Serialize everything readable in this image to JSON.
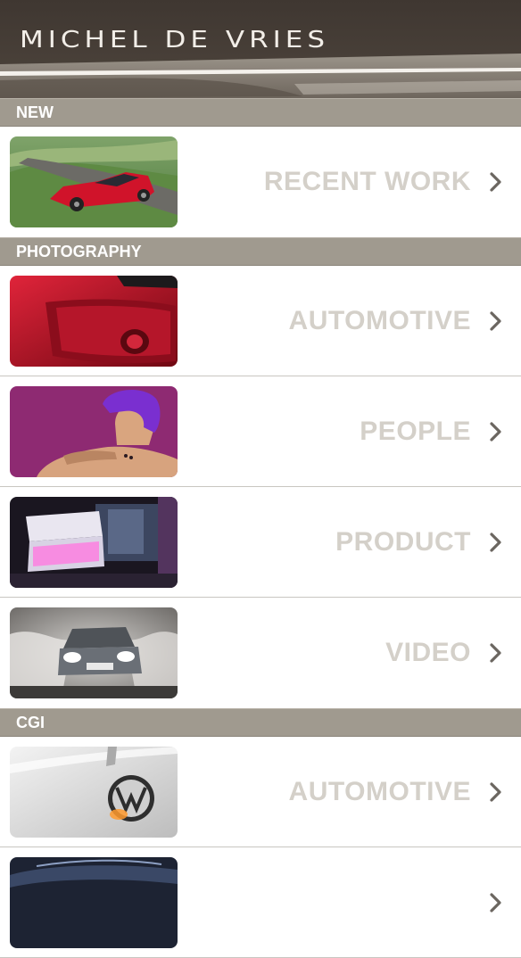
{
  "header": {
    "title": "MICHEL DE VRIES"
  },
  "sections": [
    {
      "title": "NEW",
      "items": [
        {
          "label": "RECENT WORK",
          "icon": "chevron-right-icon"
        }
      ]
    },
    {
      "title": "PHOTOGRAPHY",
      "items": [
        {
          "label": "AUTOMOTIVE",
          "icon": "chevron-right-icon"
        },
        {
          "label": "PEOPLE",
          "icon": "chevron-right-icon"
        },
        {
          "label": "PRODUCT",
          "icon": "chevron-right-icon"
        },
        {
          "label": "VIDEO",
          "icon": "chevron-right-icon"
        }
      ]
    },
    {
      "title": "CGI",
      "items": [
        {
          "label": "AUTOMOTIVE",
          "icon": "chevron-right-icon"
        },
        {
          "label": "",
          "icon": "chevron-right-icon"
        }
      ]
    }
  ],
  "colors": {
    "header_bg": "#4a413a",
    "section_bg": "#a09a8f",
    "label": "#d4d0c9",
    "chevron": "#6b6660"
  }
}
